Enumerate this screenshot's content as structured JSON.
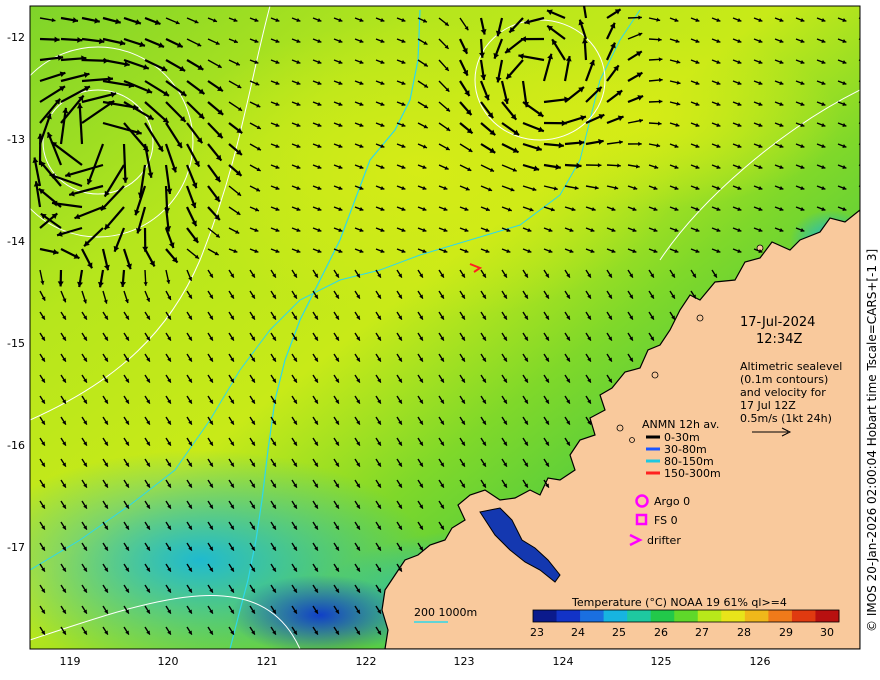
{
  "colors": {
    "land": "#f9c99c",
    "coast": "#000000",
    "contour_bathy": "#2fd8ea",
    "sealevel_contour": "#ffffff",
    "arrow": "#000000",
    "legend_marker": "#ff00ff",
    "colormap": [
      "#0b1a8c",
      "#1233c7",
      "#1a6fe0",
      "#17b4e0",
      "#1ec8a0",
      "#22c84a",
      "#5fd82a",
      "#b8e81a",
      "#e8e41a",
      "#f0b81a",
      "#f07a1a",
      "#e03a10",
      "#b81010"
    ]
  },
  "axes": {
    "lon_min": 118.6,
    "lon_max": 127.0,
    "lat_min": -18.05,
    "lat_max": -11.7,
    "x_ticks": [
      "119",
      "120",
      "121",
      "122",
      "123",
      "124",
      "125",
      "126"
    ],
    "y_ticks": [
      "-12",
      "-13",
      "-14",
      "-15",
      "-16",
      "-17"
    ]
  },
  "annotations": {
    "date": "17-Jul-2024",
    "time": "12:34Z",
    "altimetry_lines": [
      "Altimetric sealevel",
      "(0.1m contours)",
      "and velocity for",
      "17 Jul 12Z",
      "0.5m/s (1kt 24h)"
    ]
  },
  "legend": {
    "title": "ANMN 12h av.",
    "items": [
      {
        "label": "0-30m",
        "color": "#000000"
      },
      {
        "label": "30-80m",
        "color": "#1a55ff"
      },
      {
        "label": "80-150m",
        "color": "#1ec8e0"
      },
      {
        "label": "150-300m",
        "color": "#ff2020"
      }
    ],
    "argo": "Argo 0",
    "fs": "FS 0",
    "drifter": "drifter"
  },
  "bathy_legend": {
    "label": "200  1000m"
  },
  "colorbar": {
    "title": "Temperature (°C) NOAA 19 61% ql>=4",
    "ticks": [
      "23",
      "24",
      "25",
      "26",
      "27",
      "28",
      "29",
      "30"
    ]
  },
  "side_text": "© IMOS 20-Jan-2026 02:00:04 Hobart time Tscale=CARS+[-1 3]"
}
